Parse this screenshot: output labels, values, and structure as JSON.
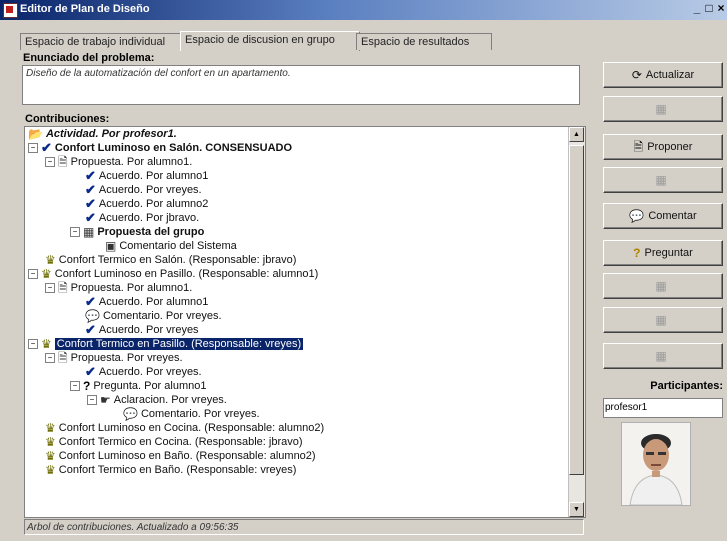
{
  "window": {
    "title": "Editor de Plan de Diseño",
    "controls": [
      "_",
      "□",
      "×"
    ]
  },
  "tabs": [
    {
      "label": "Espacio de trabajo individual",
      "active": false
    },
    {
      "label": "Espacio de discusion en grupo",
      "active": true
    },
    {
      "label": "Espacio de resultados",
      "active": false
    }
  ],
  "problem": {
    "label": "Enunciado del problema:",
    "text": "Diseño de la automatización del confort en un apartamento."
  },
  "contributions": {
    "label": "Contribuciones:",
    "tree": [
      {
        "text": "Actividad. Por profesor1.",
        "icon": "folder-icon"
      },
      {
        "text": "Confort Luminoso en Salón. CONSENSUADO",
        "icon": "check-icon"
      },
      {
        "text": "Propuesta. Por alumno1.",
        "icon": "document-icon"
      },
      {
        "text": "Acuerdo. Por alumno1",
        "icon": "check-icon"
      },
      {
        "text": "Acuerdo. Por vreyes.",
        "icon": "check-icon"
      },
      {
        "text": "Acuerdo. Por alumno2",
        "icon": "check-icon"
      },
      {
        "text": "Acuerdo. Por jbravo.",
        "icon": "check-icon"
      },
      {
        "text": "Propuesta del grupo",
        "icon": "group-proposal-icon"
      },
      {
        "text": "Comentario del Sistema",
        "icon": "system-comment-icon"
      },
      {
        "text": "Confort Termico en Salón. (Responsable: jbravo)",
        "icon": "group-icon"
      },
      {
        "text": "Confort Luminoso en Pasillo. (Responsable: alumno1)",
        "icon": "group-icon"
      },
      {
        "text": "Propuesta. Por alumno1.",
        "icon": "document-icon"
      },
      {
        "text": "Acuerdo. Por alumno1",
        "icon": "check-icon"
      },
      {
        "text": "Comentario. Por vreyes.",
        "icon": "comment-icon"
      },
      {
        "text": "Acuerdo. Por vreyes",
        "icon": "check-icon"
      },
      {
        "text": "Confort Termico en Pasillo. (Responsable: vreyes)",
        "icon": "group-icon",
        "selected": true
      },
      {
        "text": "Propuesta. Por vreyes.",
        "icon": "document-icon"
      },
      {
        "text": "Acuerdo. Por vreyes.",
        "icon": "check-icon"
      },
      {
        "text": "Pregunta. Por alumno1",
        "icon": "question-icon"
      },
      {
        "text": "Aclaracion. Por vreyes.",
        "icon": "clarification-icon"
      },
      {
        "text": "Comentario. Por vreyes.",
        "icon": "comment-icon"
      },
      {
        "text": "Confort Luminoso en Cocina. (Responsable: alumno2)",
        "icon": "group-icon"
      },
      {
        "text": "Confort Termico en Cocina. (Responsable: jbravo)",
        "icon": "group-icon"
      },
      {
        "text": "Confort Luminoso en Baño. (Responsable: alumno2)",
        "icon": "group-icon"
      },
      {
        "text": "Confort Termico en Baño. (Responsable: vreyes)",
        "icon": "group-icon"
      }
    ]
  },
  "status": "Arbol de contribuciones. Actualizado a 09:56:35",
  "buttons": [
    {
      "label": "Actualizar",
      "enabled": true,
      "icon": "refresh-icon"
    },
    {
      "label": "",
      "enabled": false,
      "icon": "tool-icon"
    },
    {
      "label": "Proponer",
      "enabled": true,
      "icon": "document-icon"
    },
    {
      "label": "",
      "enabled": false,
      "icon": "tool-icon"
    },
    {
      "label": "Comentar",
      "enabled": true,
      "icon": "comment-icon"
    },
    {
      "label": "Preguntar",
      "enabled": true,
      "icon": "question-icon"
    },
    {
      "label": "",
      "enabled": false,
      "icon": "tool-icon"
    },
    {
      "label": "",
      "enabled": false,
      "icon": "tool-icon"
    },
    {
      "label": "",
      "enabled": false,
      "icon": "tool-icon"
    }
  ],
  "participants": {
    "label": "Participantes:",
    "items": [
      "profesor1"
    ]
  }
}
